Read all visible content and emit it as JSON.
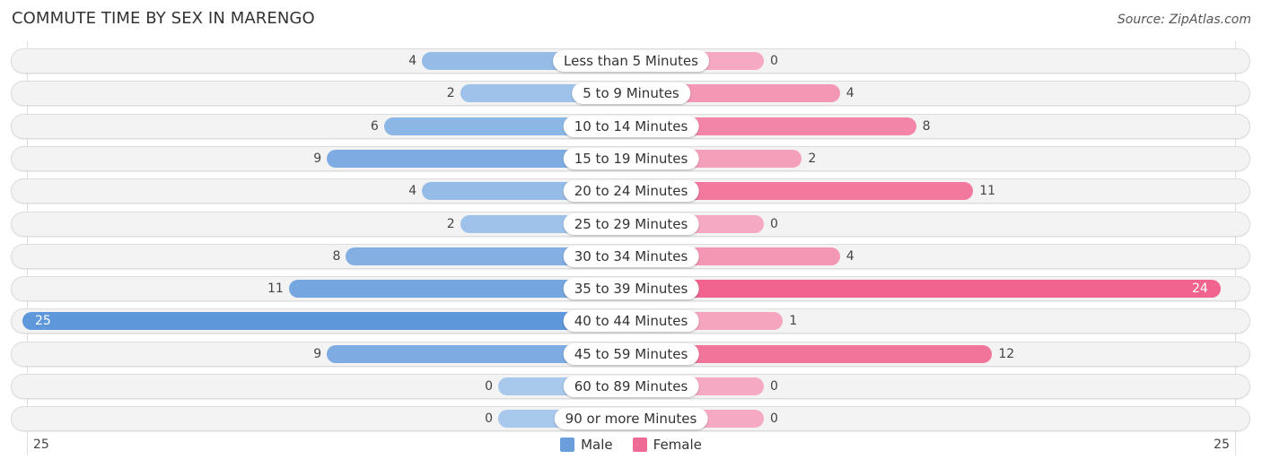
{
  "chart_data": {
    "type": "bar",
    "orientation": "horizontal-diverging",
    "title": "COMMUTE TIME BY SEX IN MARENGO",
    "source": "Source: ZipAtlas.com",
    "categories": [
      "Less than 5 Minutes",
      "5 to 9 Minutes",
      "10 to 14 Minutes",
      "15 to 19 Minutes",
      "20 to 24 Minutes",
      "25 to 29 Minutes",
      "30 to 34 Minutes",
      "35 to 39 Minutes",
      "40 to 44 Minutes",
      "45 to 59 Minutes",
      "60 to 89 Minutes",
      "90 or more Minutes"
    ],
    "series": [
      {
        "name": "Male",
        "color": "#6a9fdc",
        "values": [
          4,
          2,
          6,
          9,
          4,
          2,
          8,
          11,
          25,
          9,
          0,
          0
        ]
      },
      {
        "name": "Female",
        "color": "#f06a96",
        "values": [
          0,
          4,
          8,
          2,
          11,
          0,
          4,
          24,
          1,
          12,
          0,
          0
        ]
      }
    ],
    "axis": {
      "left_label": "25",
      "right_label": "25",
      "max": 25
    },
    "legend": {
      "position": "bottom-center",
      "items": [
        "Male",
        "Female"
      ]
    },
    "grid": false
  }
}
